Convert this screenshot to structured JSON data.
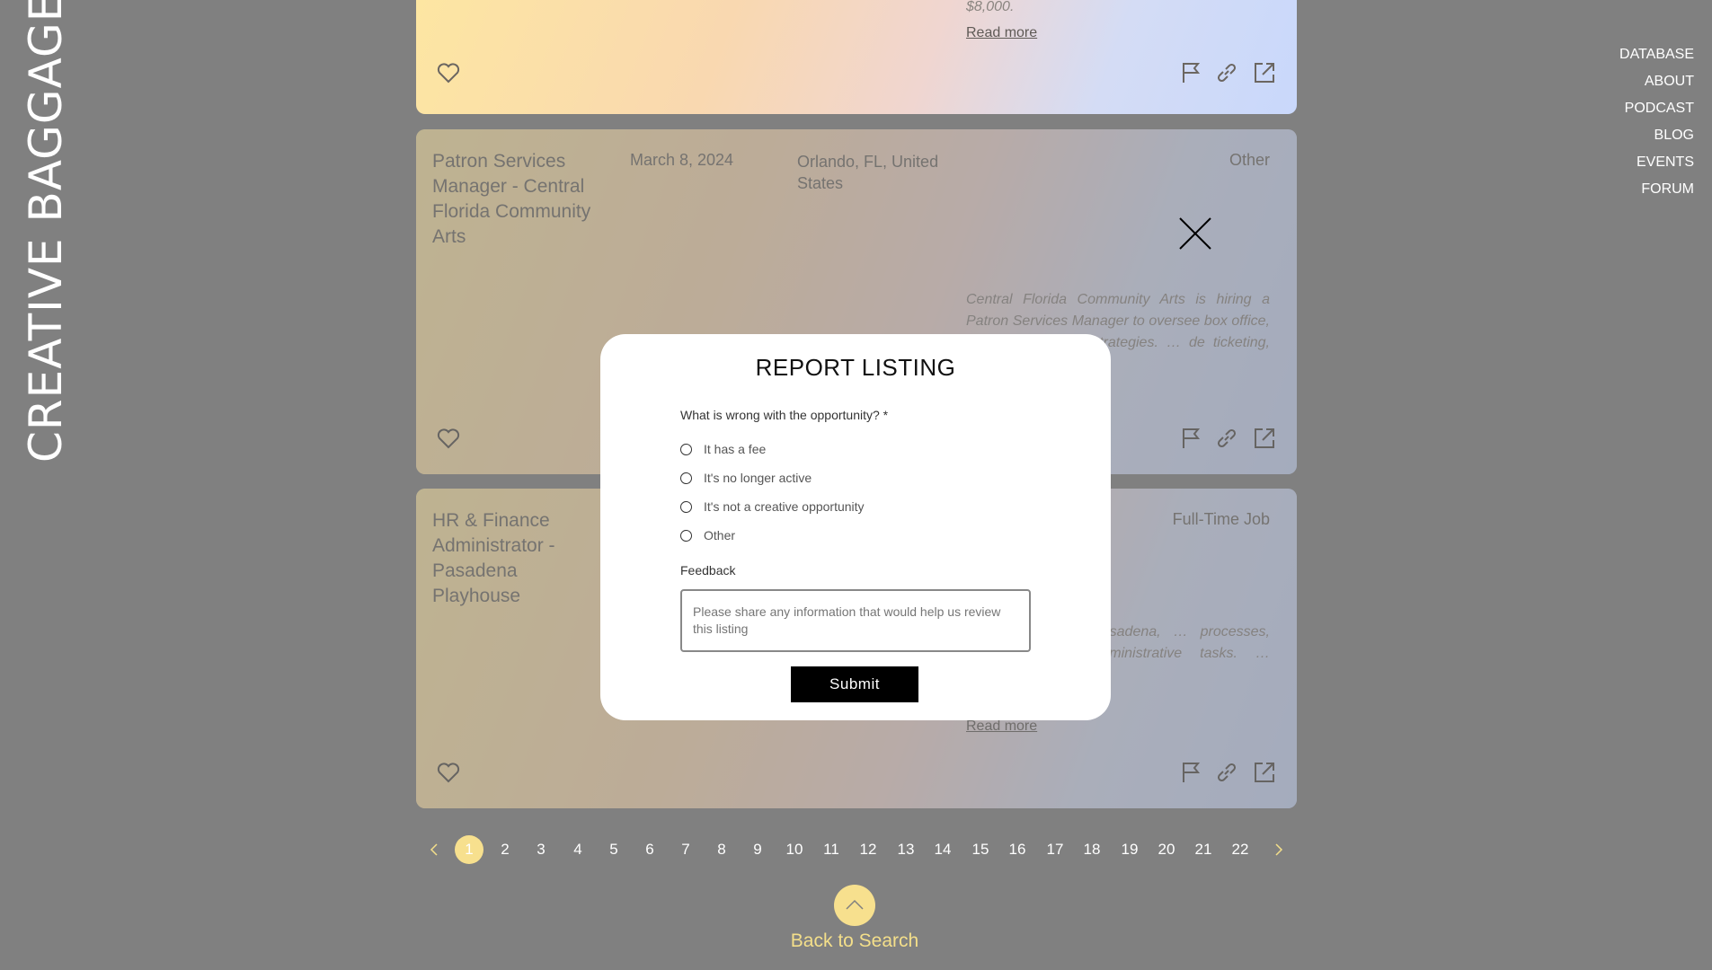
{
  "brand": "CREATIVE BAGGAGE",
  "nav": [
    "DATABASE",
    "ABOUT",
    "PODCAST",
    "BLOG",
    "EVENTS",
    "FORUM"
  ],
  "cards": [
    {
      "price_snippet": "$8,000.",
      "read_more": "Read more"
    },
    {
      "title": "Patron Services Manager - Central Florida Community Arts",
      "date": "March 8, 2024",
      "location": "Orlando, FL, United States",
      "type": "Other",
      "description": "Central Florida Community Arts is hiring a Patron Services Manager to oversee box office, … and marketing strategies. … de ticketing, datab…"
    },
    {
      "title": "HR & Finance Administrator - Pasadena Playhouse",
      "type": "Full-Time Job",
      "description": "…dministrator in Pasadena, … processes, compliance, … administrative tasks. … annually with bene…",
      "read_more": "Read more"
    }
  ],
  "pagination": {
    "current": "1",
    "pages": [
      "1",
      "2",
      "3",
      "4",
      "5",
      "6",
      "7",
      "8",
      "9",
      "10",
      "11",
      "12",
      "13",
      "14",
      "15",
      "16",
      "17",
      "18",
      "19",
      "20",
      "21",
      "22"
    ]
  },
  "back_to_search": "Back to Search",
  "modal": {
    "title": "REPORT LISTING",
    "question": "What is wrong with the opportunity? *",
    "options": [
      "It has a fee",
      "It's no longer active",
      "It's not a creative opportunity",
      "Other"
    ],
    "feedback_label": "Feedback",
    "feedback_placeholder": "Please share any information that would help us review this listing",
    "submit_label": "Submit"
  }
}
